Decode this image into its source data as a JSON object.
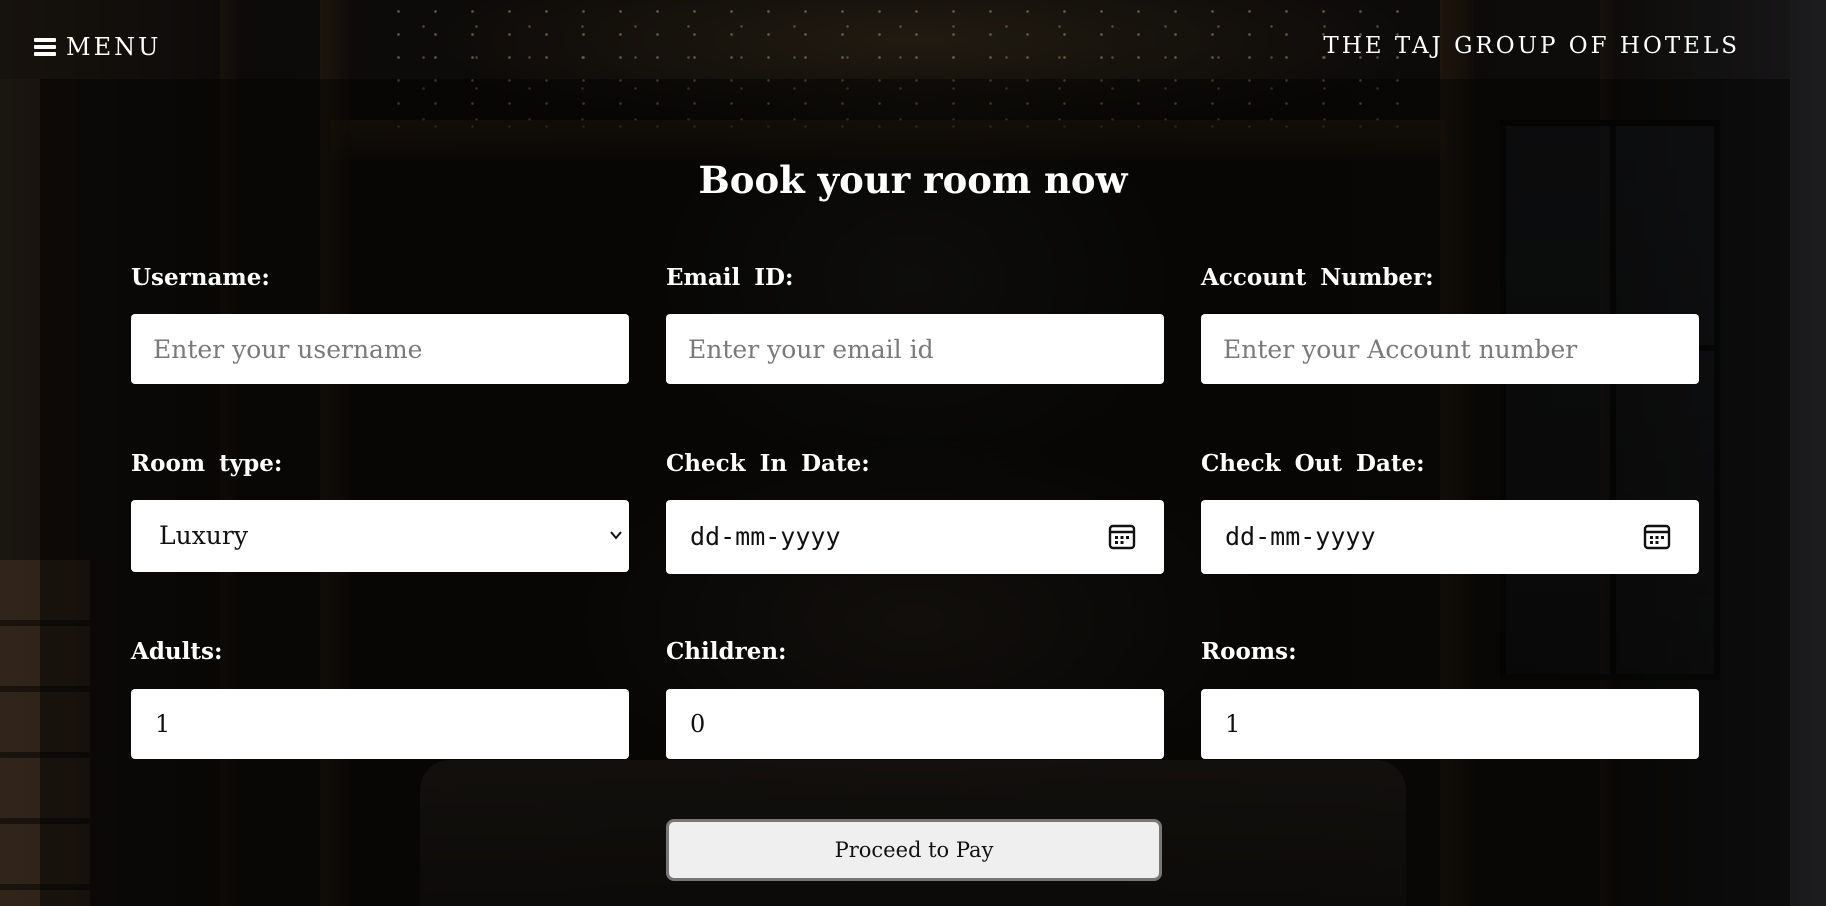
{
  "header": {
    "menu_label": "MENU",
    "brand": "THE TAJ GROUP OF HOTELS"
  },
  "form": {
    "title": "Book your room now",
    "username": {
      "label": "Username:",
      "placeholder": "Enter your username",
      "value": ""
    },
    "email": {
      "label": "Email ID:",
      "placeholder": "Enter your email id",
      "value": ""
    },
    "account": {
      "label": "Account Number:",
      "placeholder": "Enter your Account number",
      "value": ""
    },
    "room_type": {
      "label": "Room type:",
      "selected": "Luxury"
    },
    "check_in": {
      "label": "Check In Date:",
      "placeholder": "dd-mm-yyyy"
    },
    "check_out": {
      "label": "Check Out Date:",
      "placeholder": "dd-mm-yyyy"
    },
    "adults": {
      "label": "Adults:",
      "value": "1"
    },
    "children": {
      "label": "Children:",
      "value": "0"
    },
    "rooms": {
      "label": "Rooms:",
      "value": "1"
    },
    "submit_label": "Proceed to Pay"
  },
  "icons": {
    "menu": "hamburger-menu-icon",
    "calendar": "calendar-icon",
    "select": "chevron-down-icon"
  }
}
